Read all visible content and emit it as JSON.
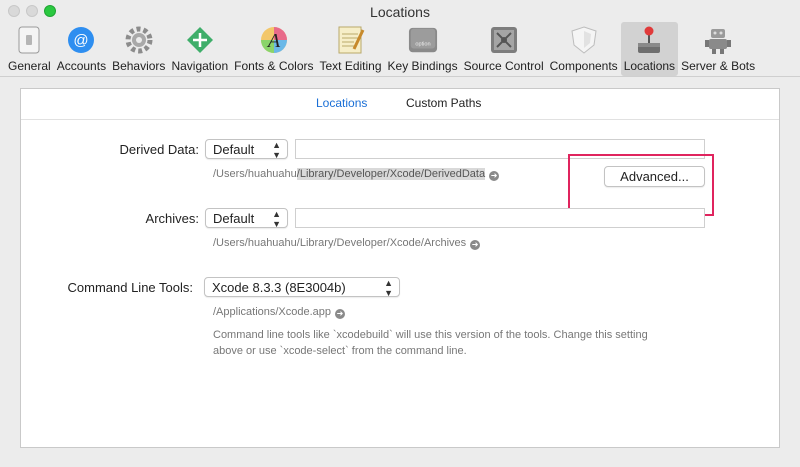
{
  "window": {
    "title": "Locations"
  },
  "toolbar": {
    "items": [
      {
        "label": "General"
      },
      {
        "label": "Accounts"
      },
      {
        "label": "Behaviors"
      },
      {
        "label": "Navigation"
      },
      {
        "label": "Fonts & Colors"
      },
      {
        "label": "Text Editing"
      },
      {
        "label": "Key Bindings"
      },
      {
        "label": "Source Control"
      },
      {
        "label": "Components"
      },
      {
        "label": "Locations"
      },
      {
        "label": "Server & Bots"
      }
    ],
    "active": "Locations"
  },
  "tabs": {
    "locations": "Locations",
    "custom_paths": "Custom Paths",
    "selected": "Locations"
  },
  "derived": {
    "label": "Derived Data:",
    "selected": "Default",
    "path_prefix": "/Users/huahuahu",
    "path_highlight": "/Library/Developer/Xcode/DerivedData",
    "advanced": "Advanced..."
  },
  "archives": {
    "label": "Archives:",
    "selected": "Default",
    "path": "/Users/huahuahu/Library/Developer/Xcode/Archives"
  },
  "clt": {
    "label": "Command Line Tools:",
    "selected": "Xcode 8.3.3 (8E3004b)",
    "path": "/Applications/Xcode.app",
    "note_line1": "Command line tools like `xcodebuild` will use this version of the tools. Change this setting",
    "note_line2": "above or use `xcode-select` from the command line."
  },
  "colors": {
    "accent": "#1a6fd6",
    "annotation": "#e0245e"
  }
}
